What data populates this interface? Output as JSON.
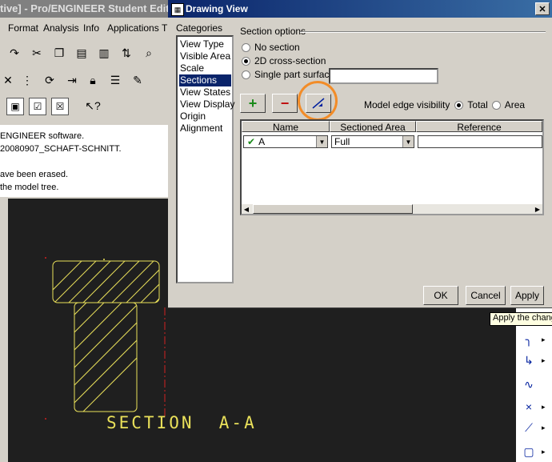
{
  "app": {
    "title": "tive] - Pro/ENGINEER Student Editio",
    "menu": [
      "Format",
      "Analysis",
      "Info",
      "Applications",
      "T"
    ],
    "messages": [
      "ENGINEER software.",
      "20080907_SCHAFT-SCHNITT.",
      "",
      "ave been erased.",
      " the model tree."
    ],
    "section_label": "SECTION  A-A",
    "tooltip": "Apply the chang"
  },
  "dialog": {
    "title": "Drawing View",
    "close": "✕",
    "categories_label": "Categories",
    "categories": [
      "View Type",
      "Visible Area",
      "Scale",
      "Sections",
      "View States",
      "View Display",
      "Origin",
      "Alignment"
    ],
    "selected_category": "Sections",
    "section_options_label": "Section options",
    "radio_no_section": "No section",
    "radio_2d": "2D cross-section",
    "radio_single_part": "Single part surface",
    "single_part_value": "",
    "model_edge_label": "Model edge visibility",
    "edge_total": "Total",
    "edge_area": "Area",
    "table": {
      "headers": [
        "Name",
        "Sectioned Area",
        "Reference"
      ],
      "rows": [
        {
          "name": "A",
          "area": "Full",
          "reference": ""
        }
      ]
    },
    "buttons": {
      "ok": "OK",
      "cancel": "Cancel",
      "apply": "Apply"
    },
    "icons": {
      "add": "+",
      "remove": "−"
    }
  },
  "colors": {
    "accent_ring": "#f28c28",
    "section_text": "#e9e05a",
    "title_bar": "#0a246a"
  }
}
